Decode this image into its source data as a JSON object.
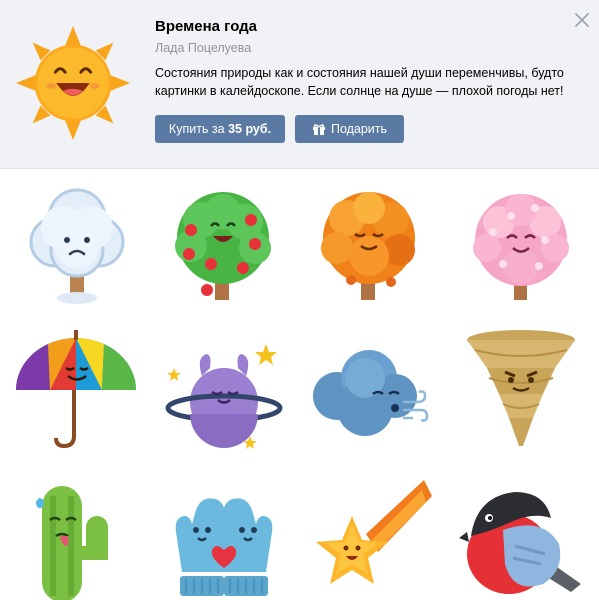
{
  "pack": {
    "title": "Времена года",
    "author": "Лада Поцелуева",
    "description": "Состояния природы как и состояния нашей души переменчивы, будто картинки в калейдоскопе. Если солнце на душе — плохой погоды нет!"
  },
  "buttons": {
    "buy_prefix": "Купить за ",
    "buy_price": "35 руб.",
    "gift_label": "Подарить"
  },
  "icons": {
    "hero": "sun-sticker-icon",
    "close": "close-icon",
    "gift": "gift-icon"
  },
  "stickers": [
    "sad-cloud-tree-sticker",
    "apple-tree-sticker",
    "autumn-tree-sticker",
    "blossom-tree-sticker",
    "rainbow-umbrella-sticker",
    "planet-sticker",
    "blowing-cloud-sticker",
    "tornado-sticker",
    "cactus-sticker",
    "mittens-sticker",
    "shooting-star-sticker",
    "bullfinch-sticker"
  ],
  "colors": {
    "header_bg": "#f0f2f5",
    "button": "#5b7aa3",
    "author": "#939393"
  }
}
